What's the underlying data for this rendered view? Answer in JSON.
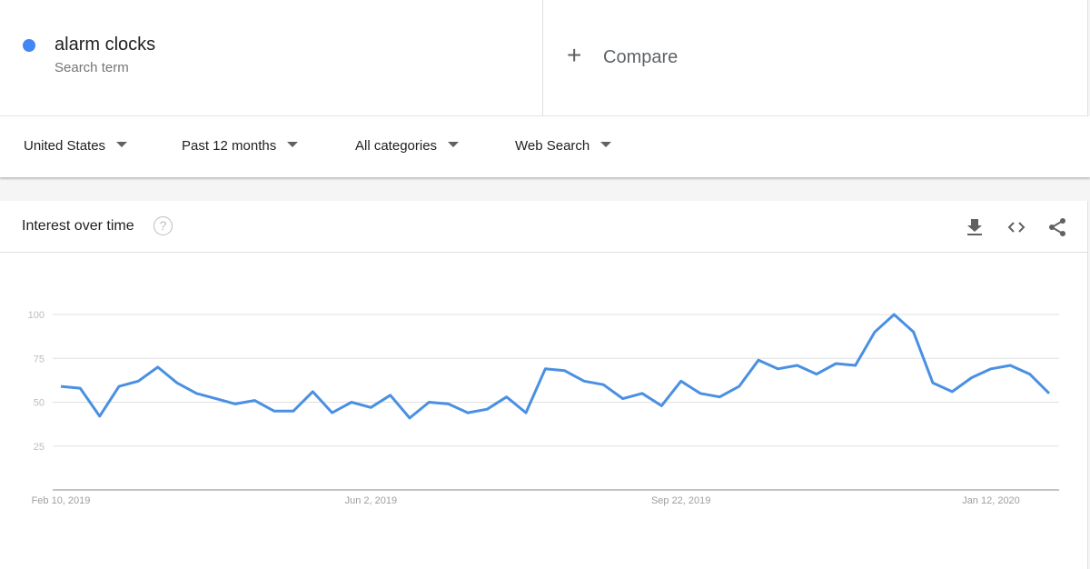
{
  "search_term": {
    "name": "alarm clocks",
    "label": "Search term",
    "color": "#4285f4"
  },
  "compare": {
    "icon": "plus-icon",
    "label": "Compare"
  },
  "filters": [
    {
      "label": "United States",
      "icon": "caret-down-icon"
    },
    {
      "label": "Past 12 months",
      "icon": "caret-down-icon"
    },
    {
      "label": "All categories",
      "icon": "caret-down-icon"
    },
    {
      "label": "Web Search",
      "icon": "caret-down-icon"
    }
  ],
  "panel": {
    "title": "Interest over time",
    "help_icon": "help-icon",
    "help_glyph": "?",
    "actions": [
      "download-icon",
      "embed-code-icon",
      "share-icon"
    ]
  },
  "chart_data": {
    "type": "line",
    "title": "Interest over time",
    "xlabel": "",
    "ylabel": "",
    "ylim": [
      0,
      100
    ],
    "yticks": [
      25,
      50,
      75,
      100
    ],
    "grid": true,
    "x_tick_labels": [
      {
        "index": 0,
        "label": "Feb 10, 2019"
      },
      {
        "index": 16,
        "label": "Jun 2, 2019"
      },
      {
        "index": 32,
        "label": "Sep 22, 2019"
      },
      {
        "index": 48,
        "label": "Jan 12, 2020"
      }
    ],
    "x_start": "Feb 10, 2019",
    "x_interval": "weekly",
    "series": [
      {
        "name": "alarm clocks",
        "color": "#4a90e2",
        "values": [
          59,
          58,
          42,
          59,
          62,
          70,
          61,
          55,
          52,
          49,
          51,
          45,
          45,
          56,
          44,
          50,
          47,
          54,
          41,
          50,
          49,
          44,
          46,
          53,
          44,
          69,
          68,
          62,
          60,
          52,
          55,
          48,
          62,
          55,
          53,
          59,
          74,
          69,
          71,
          66,
          72,
          71,
          90,
          100,
          90,
          61,
          56,
          64,
          69,
          71,
          66,
          55
        ]
      }
    ]
  }
}
